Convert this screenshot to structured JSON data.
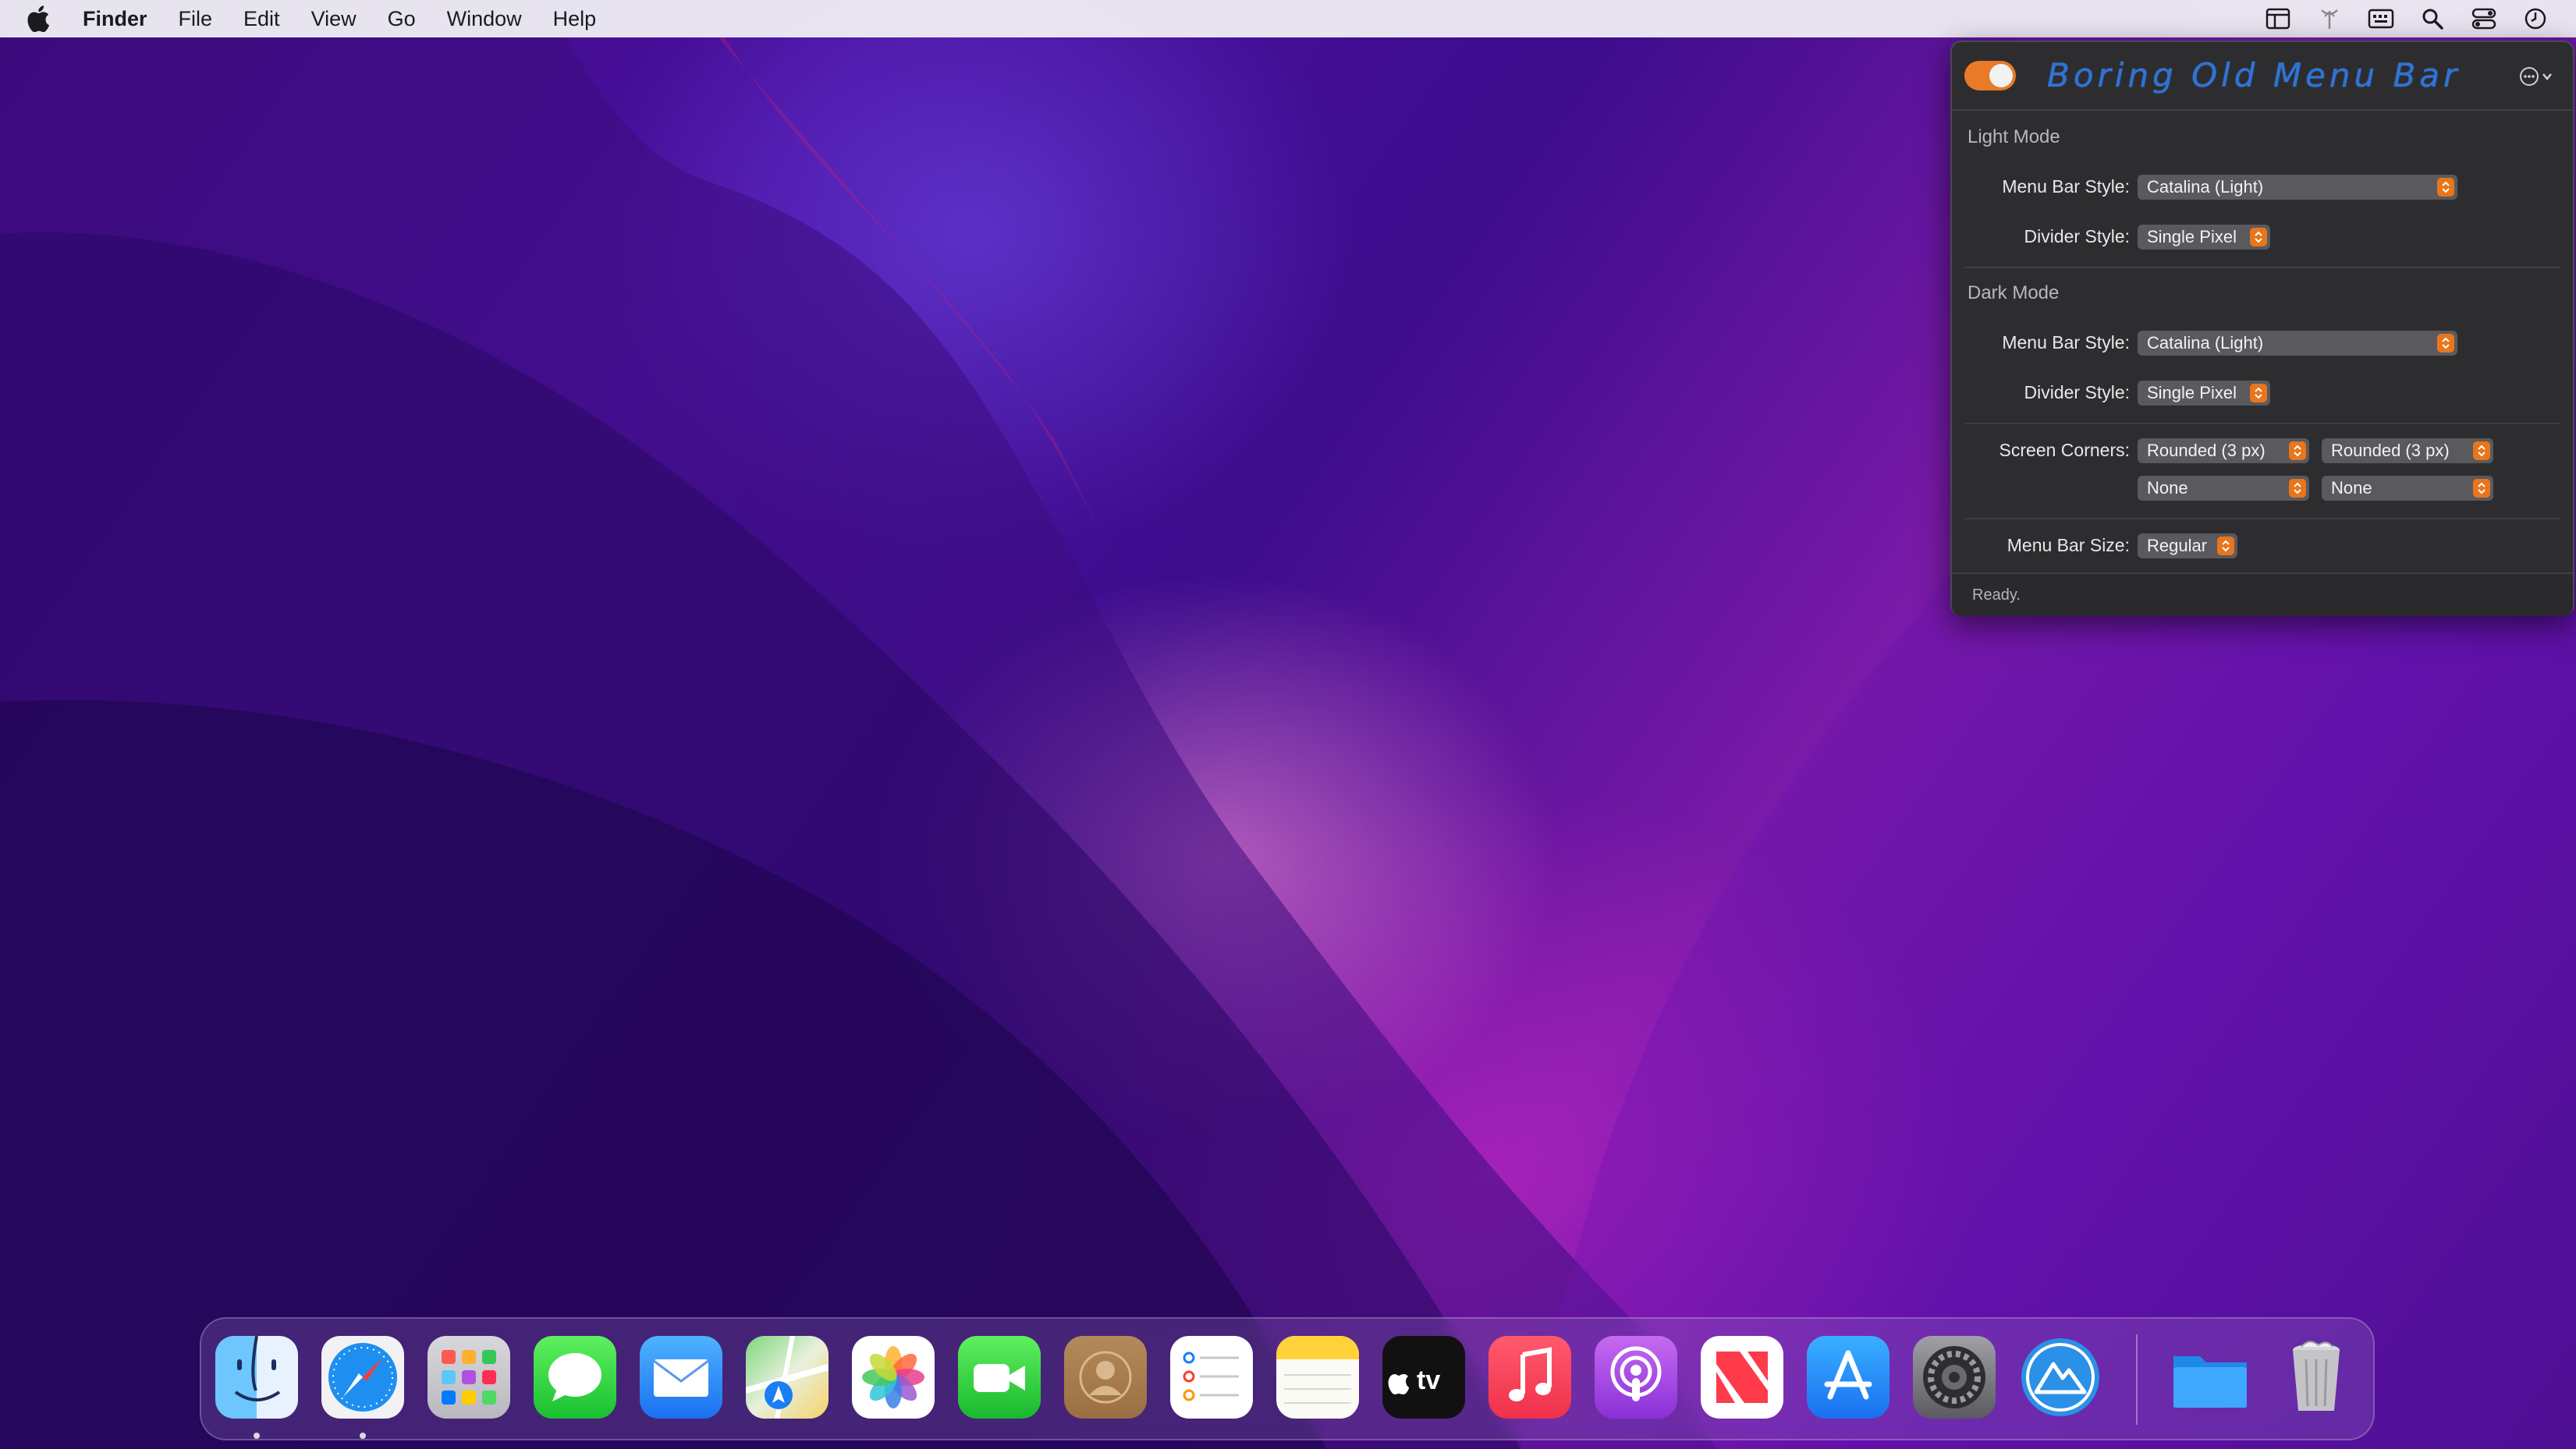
{
  "menubar": {
    "app_name": "Finder",
    "items": [
      "File",
      "Edit",
      "View",
      "Go",
      "Window",
      "Help"
    ]
  },
  "status_icons": [
    "window-icon",
    "antenna-icon",
    "keyboard-icon",
    "search-icon",
    "control-center-icon",
    "clock-icon"
  ],
  "panel": {
    "title": "Boring Old Menu Bar",
    "enabled": true,
    "accent_color": "#e8761c",
    "light_mode": {
      "heading": "Light Mode",
      "menu_bar_style_label": "Menu Bar Style:",
      "menu_bar_style": "Catalina (Light)",
      "divider_style_label": "Divider Style:",
      "divider_style": "Single Pixel"
    },
    "dark_mode": {
      "heading": "Dark Mode",
      "menu_bar_style_label": "Menu Bar Style:",
      "menu_bar_style": "Catalina (Light)",
      "divider_style_label": "Divider Style:",
      "divider_style": "Single Pixel"
    },
    "screen_corners": {
      "label": "Screen Corners:",
      "top_left": "Rounded (3 px)",
      "top_right": "Rounded (3 px)",
      "bottom_left": "None",
      "bottom_right": "None"
    },
    "menu_bar_size": {
      "label": "Menu Bar Size:",
      "value": "Regular"
    },
    "status": "Ready."
  },
  "dock": {
    "apps": [
      "Finder",
      "Safari",
      "Launchpad",
      "Messages",
      "Mail",
      "Maps",
      "Photos",
      "FaceTime",
      "Contacts",
      "Reminders",
      "Notes",
      "TV",
      "Music",
      "Podcasts",
      "News",
      "App Store",
      "System Preferences",
      "Boring Old Menu Bar"
    ],
    "tv_label": "tv",
    "running": [
      "Finder",
      "Safari"
    ],
    "extras": [
      "Downloads",
      "Trash"
    ]
  }
}
